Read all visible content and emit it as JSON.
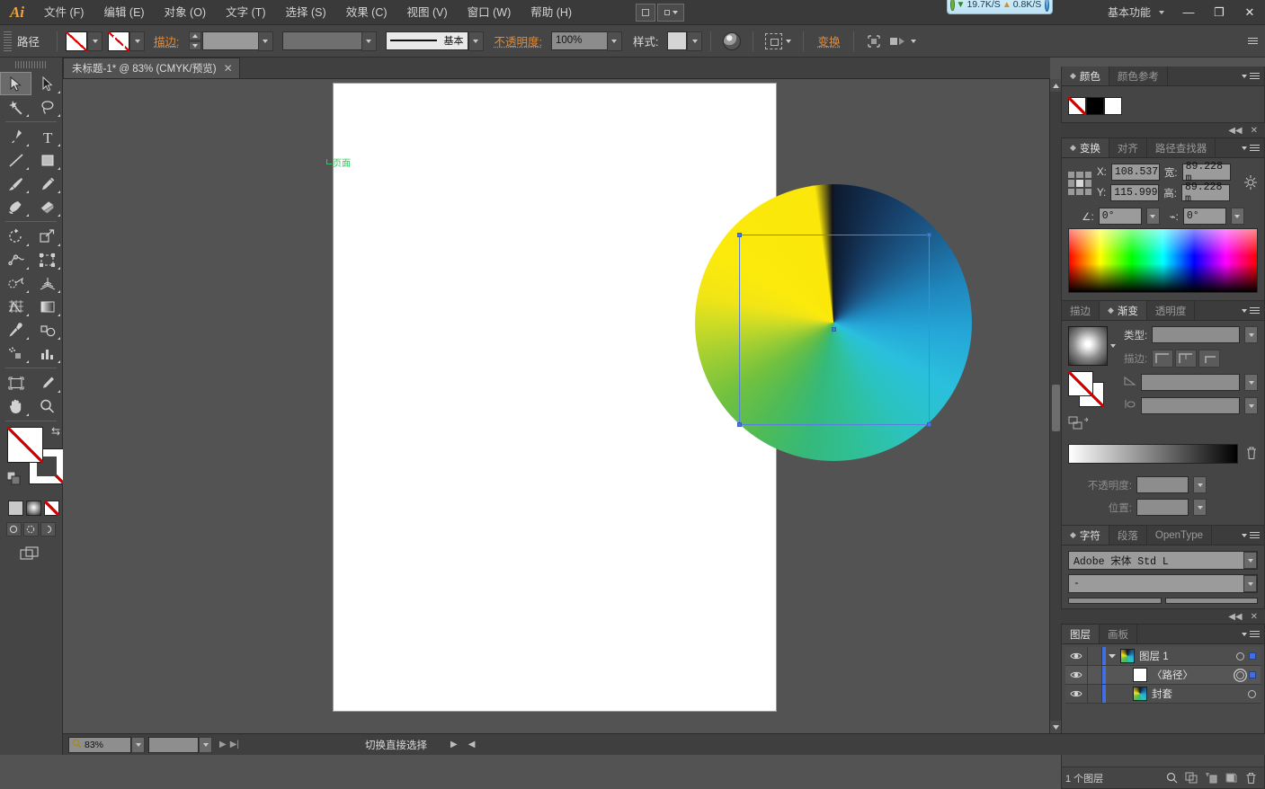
{
  "app": {
    "logo": "Ai",
    "workspace": "基本功能"
  },
  "menu": {
    "items": [
      {
        "label": "文件 (F)"
      },
      {
        "label": "编辑 (E)"
      },
      {
        "label": "对象 (O)"
      },
      {
        "label": "文字 (T)"
      },
      {
        "label": "选择 (S)"
      },
      {
        "label": "效果 (C)"
      },
      {
        "label": "视图 (V)"
      },
      {
        "label": "窗口 (W)"
      },
      {
        "label": "帮助 (H)"
      }
    ]
  },
  "network_widget": {
    "download": "19.7K/S",
    "upload": "0.8K/S"
  },
  "window_controls": {
    "minimize": "—",
    "maximize": "❐",
    "close": "✕"
  },
  "control_bar": {
    "object_label": "路径",
    "fill_swatch": "none",
    "stroke_swatch": "none",
    "stroke_label": "描边:",
    "stroke_weight": "",
    "stroke_profile_value": "基本",
    "opacity_label": "不透明度:",
    "opacity_value": "100%",
    "style_label": "样式:",
    "transform_label": "变换",
    "align_icon": "align-icon",
    "isolate_icon": "isolate-icon"
  },
  "document_tab": {
    "title": "未标题-1* @ 83% (CMYK/预览)",
    "close": "✕"
  },
  "toolbar": {
    "tools": [
      {
        "name": "selection-tool",
        "active": true
      },
      {
        "name": "direct-selection-tool",
        "active": false
      },
      {
        "name": "magic-wand-tool",
        "active": false
      },
      {
        "name": "lasso-tool",
        "active": false
      },
      {
        "name": "pen-tool",
        "active": false
      },
      {
        "name": "type-tool",
        "active": false
      },
      {
        "name": "line-segment-tool",
        "active": false
      },
      {
        "name": "rectangle-tool",
        "active": false
      },
      {
        "name": "paintbrush-tool",
        "active": false
      },
      {
        "name": "pencil-tool",
        "active": false
      },
      {
        "name": "blob-brush-tool",
        "active": false
      },
      {
        "name": "eraser-tool",
        "active": false
      },
      {
        "name": "rotate-tool",
        "active": false
      },
      {
        "name": "scale-tool",
        "active": false
      },
      {
        "name": "width-tool",
        "active": false
      },
      {
        "name": "free-transform-tool",
        "active": false
      },
      {
        "name": "shape-builder-tool",
        "active": false
      },
      {
        "name": "perspective-grid-tool",
        "active": false
      },
      {
        "name": "mesh-tool",
        "active": false
      },
      {
        "name": "gradient-tool",
        "active": false
      },
      {
        "name": "eyedropper-tool",
        "active": false
      },
      {
        "name": "blend-tool",
        "active": false
      },
      {
        "name": "symbol-sprayer-tool",
        "active": false
      },
      {
        "name": "column-graph-tool",
        "active": false
      },
      {
        "name": "artboard-tool",
        "active": false
      },
      {
        "name": "slice-tool",
        "active": false
      },
      {
        "name": "hand-tool",
        "active": false
      },
      {
        "name": "zoom-tool",
        "active": false
      }
    ],
    "fill_state": "none",
    "stroke_state": "none"
  },
  "canvas": {
    "artboard_label": "页面",
    "zoom_percent": "83%",
    "artwork": {
      "type": "conic-gradient-circle",
      "description": "圆形渐变网格对象",
      "stops": [
        {
          "angle_deg": 0,
          "color": "#0d1a2e"
        },
        {
          "angle_deg": 48,
          "color": "#1c5b8c"
        },
        {
          "angle_deg": 96,
          "color": "#25a8d8"
        },
        {
          "angle_deg": 146,
          "color": "#2bc3c0"
        },
        {
          "angle_deg": 192,
          "color": "#35b97a"
        },
        {
          "angle_deg": 236,
          "color": "#72c13f"
        },
        {
          "angle_deg": 282,
          "color": "#f2e516"
        },
        {
          "angle_deg": 358,
          "color": "#1a1a1a"
        }
      ],
      "selection_color": "#5a7fe0"
    }
  },
  "panels": {
    "color": {
      "tabs": [
        {
          "label": "颜色",
          "active": true
        },
        {
          "label": "颜色参考",
          "active": false
        }
      ],
      "swatches": [
        "none",
        "#000000",
        "#ffffff"
      ]
    },
    "transform": {
      "tabs": [
        {
          "label": "变换",
          "active": true
        },
        {
          "label": "对齐",
          "active": false
        },
        {
          "label": "路径查找器",
          "active": false
        }
      ],
      "fields": [
        {
          "label": "X:",
          "value": "108.537"
        },
        {
          "label": "宽:",
          "value": "89.228 m"
        },
        {
          "label": "Y:",
          "value": "115.999"
        },
        {
          "label": "高:",
          "value": "89.228 m"
        }
      ],
      "rotate_label": "∠:",
      "rotate_value": "0°",
      "shear_label": "⌁:",
      "shear_value": "0°"
    },
    "gradient": {
      "tabs": [
        {
          "label": "描边",
          "active": false
        },
        {
          "label": "渐变",
          "active": true
        },
        {
          "label": "透明度",
          "active": false
        }
      ],
      "type_label": "类型:",
      "type_value": "",
      "stroke_label": "描边:",
      "angle_value": "",
      "aspect_value": "",
      "opacity_label": "不透明度:",
      "opacity_value": "",
      "position_label": "位置:",
      "position_value": "",
      "gradient_from": "#ffffff",
      "gradient_to": "#000000",
      "delete_icon": "trash-icon"
    },
    "character": {
      "tabs": [
        {
          "label": "字符",
          "active": true
        },
        {
          "label": "段落",
          "active": false
        },
        {
          "label": "OpenType",
          "active": false
        }
      ],
      "font_family": "Adobe 宋体 Std L",
      "font_style": "-"
    },
    "layers": {
      "tabs": [
        {
          "label": "图层",
          "active": true
        },
        {
          "label": "画板",
          "active": false
        }
      ],
      "rows": [
        {
          "name": "图层 1",
          "indent": 0,
          "expanded": true,
          "thumb": "gradient",
          "selected": false,
          "has_square": true,
          "target": "circle"
        },
        {
          "name": "〈路径〉",
          "indent": 1,
          "expanded": false,
          "thumb": "white",
          "selected": true,
          "has_square": true,
          "target": "double-circle"
        },
        {
          "name": "封套",
          "indent": 1,
          "expanded": false,
          "thumb": "gradient",
          "selected": false,
          "has_square": false,
          "target": "circle"
        }
      ],
      "footer_count": "1 个图层",
      "footer_icons": [
        "search-icon",
        "make-mask-icon",
        "new-sublayer-icon",
        "new-layer-icon",
        "trash-icon"
      ]
    }
  },
  "statusbar": {
    "zoom_value": "83%",
    "tool_status": "切换直接选择",
    "nav_next": "▶",
    "nav_last": "▶|",
    "arrow_right": "▶",
    "arrow_left": "◀"
  }
}
